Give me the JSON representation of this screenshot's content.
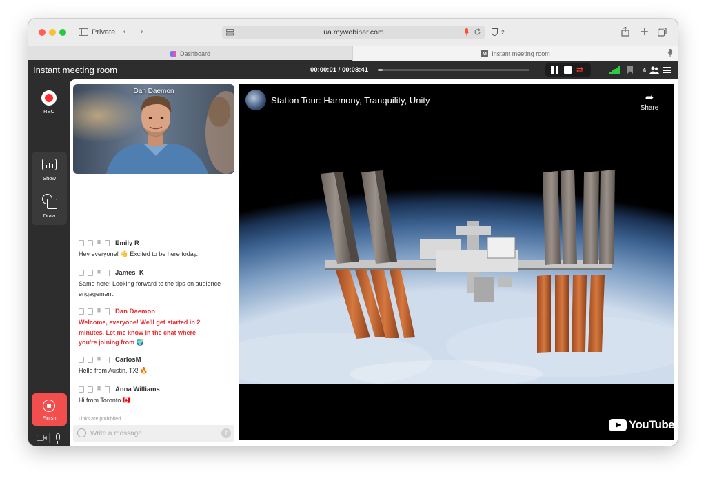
{
  "browser": {
    "private_label": "Private",
    "url": "ua.mywebinar.com",
    "shield_count": "2",
    "tabs": [
      {
        "label": "Dashboard"
      },
      {
        "label": "Instant meeting room",
        "favicon_letter": "M"
      }
    ]
  },
  "room": {
    "title": "Instant meeting room",
    "timer": "00:00:01 / 00:08:41",
    "progress_fraction": 0.01,
    "participants": "4"
  },
  "rail": {
    "rec_label": "REC",
    "show_label": "Show",
    "draw_label": "Draw",
    "finish_label": "Finish"
  },
  "video": {
    "presenter_name": "Dan Daemon"
  },
  "chat": {
    "messages": [
      {
        "author": "Emily R",
        "text": "Hey everyone! 👋 Excited to be here today."
      },
      {
        "author": "James_K",
        "text": "Same here! Looking forward to the tips on audience engagement."
      },
      {
        "author": "Dan Daemon",
        "text": "Welcome, everyone! We'll get started in 2 minutes. Let me know in the chat where you're joining from 🌍",
        "host": true
      },
      {
        "author": "CarlosM",
        "text": "Hello from Austin, TX! 🔥"
      },
      {
        "author": "Anna Williams",
        "text": "Hi from Toronto 🇨🇦"
      }
    ],
    "links_note": "Links are prohibited",
    "input_placeholder": "Write a message..."
  },
  "player": {
    "title": "Station Tour: Harmony, Tranquility, Unity",
    "share_label": "Share",
    "logo_text": "YouTube"
  },
  "colors": {
    "accent_red": "#f24e4e",
    "host_message": "#ee2b2b",
    "signal_green": "#2ecc40"
  }
}
